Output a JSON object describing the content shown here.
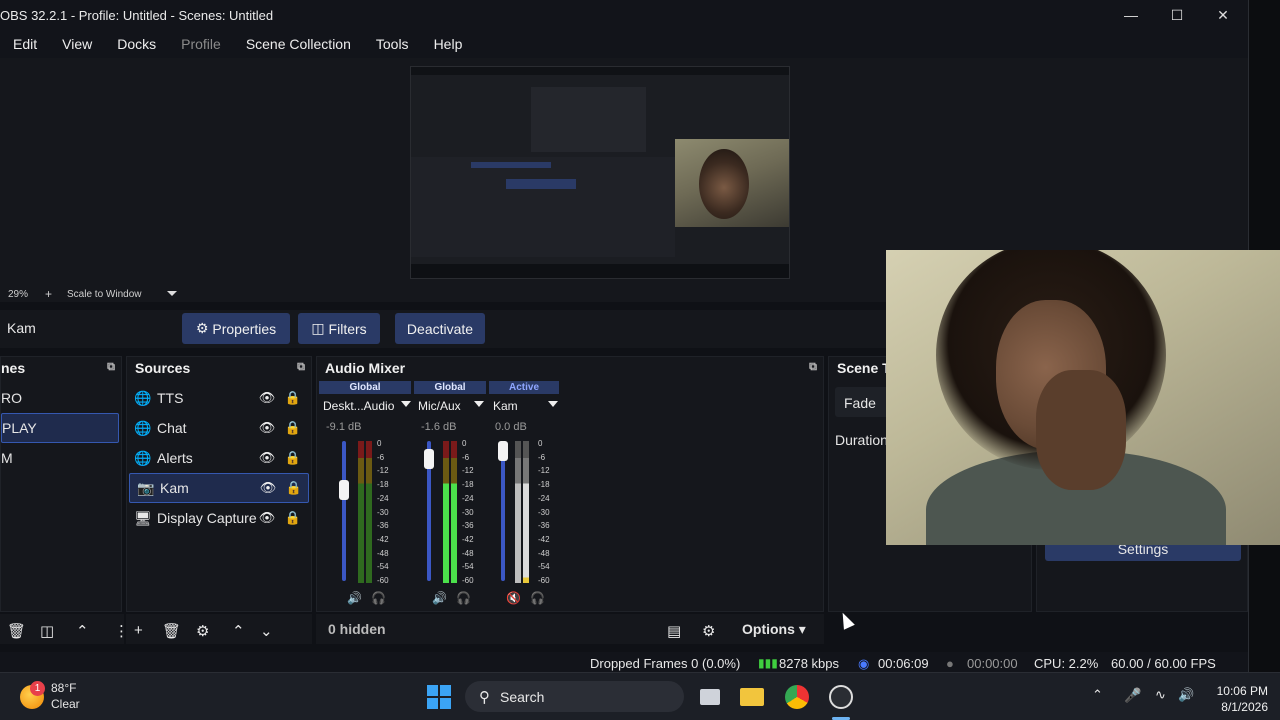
{
  "window": {
    "title": "OBS 32.2.1 - Profile: Untitled - Scenes: Untitled"
  },
  "menu": [
    "Edit",
    "View",
    "Docks",
    "Profile",
    "Scene Collection",
    "Tools",
    "Help"
  ],
  "preview": {
    "zoom": "29%",
    "scale_mode": "Scale to Window"
  },
  "source_toolbar": {
    "selected_source": "Kam",
    "properties_label": "Properties",
    "filters_label": "Filters",
    "deactivate_label": "Deactivate"
  },
  "scenes": {
    "title": "nes",
    "items": [
      "RO",
      "PLAY",
      "M"
    ]
  },
  "sources": {
    "title": "Sources",
    "items": [
      {
        "name": "TTS",
        "icon": "globe-icon"
      },
      {
        "name": "Chat",
        "icon": "globe-icon"
      },
      {
        "name": "Alerts",
        "icon": "globe-icon"
      },
      {
        "name": "Kam",
        "icon": "camera-icon"
      },
      {
        "name": "Display Capture",
        "icon": "monitor-icon"
      }
    ]
  },
  "mixer": {
    "title": "Audio Mixer",
    "channels": [
      {
        "tag": "Global",
        "name": "Deskt...Audio",
        "db": "-9.1 dB",
        "muted": false
      },
      {
        "tag": "Global",
        "name": "Mic/Aux",
        "db": "-1.6 dB",
        "muted": false
      },
      {
        "tag": "Active",
        "name": "Kam",
        "db": "0.0 dB",
        "muted": true
      }
    ],
    "scale": [
      "0",
      "-6",
      "-12",
      "-18",
      "-24",
      "-30",
      "-36",
      "-42",
      "-48",
      "-54",
      "-60"
    ],
    "hidden_label": "0 hidden",
    "options_label": "Options"
  },
  "transitions": {
    "title": "Scene T",
    "type": "Fade",
    "duration_label": "Duration",
    "settings_label": "Settings"
  },
  "status": {
    "dropped": "Dropped Frames 0 (0.0%)",
    "bitrate": "8278 kbps",
    "stream_time": "00:06:09",
    "rec_time": "00:00:00",
    "cpu": "CPU: 2.2%",
    "fps": "60.00 / 60.00 FPS"
  },
  "taskbar": {
    "weather_temp": "88°F",
    "weather_desc": "Clear",
    "weather_badge": "1",
    "search_label": "Search",
    "time": "10:06 PM",
    "date": "8/1/2026"
  }
}
